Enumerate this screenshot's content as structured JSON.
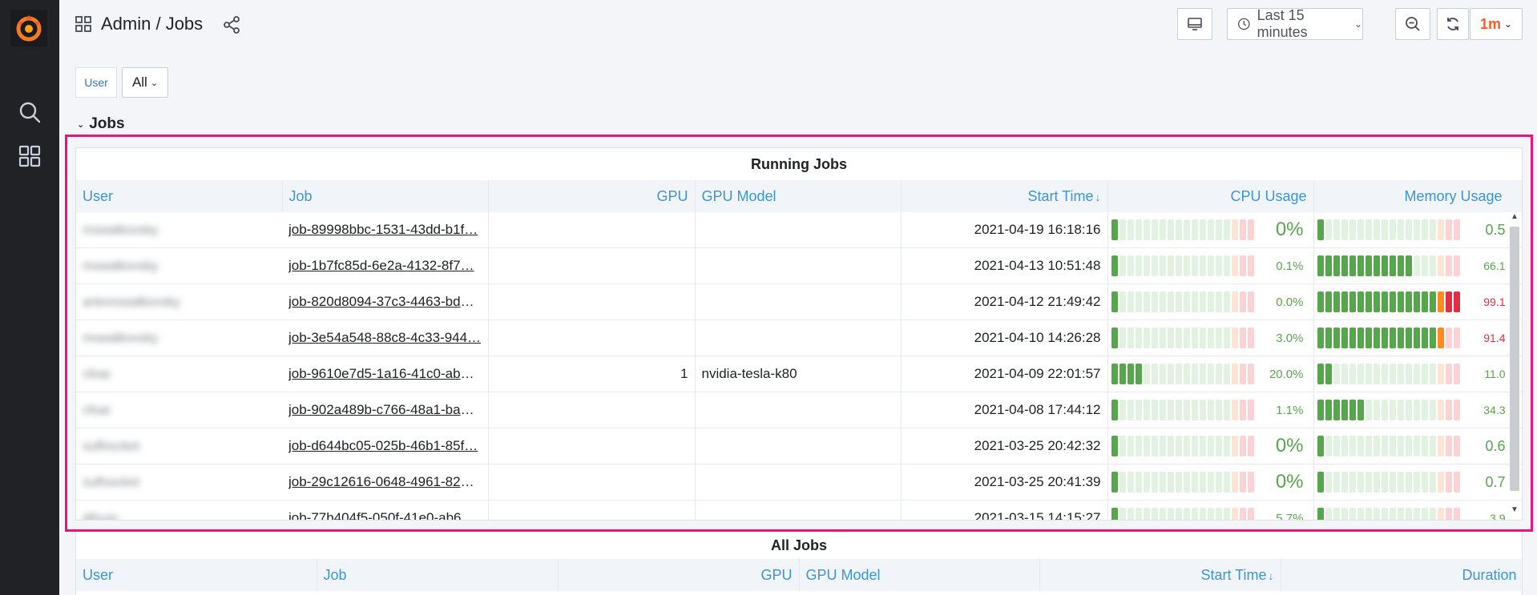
{
  "app": {
    "title": "Admin / Jobs"
  },
  "toolbar": {
    "time_range": "Last 15 minutes",
    "refresh_interval": "1m"
  },
  "variables": {
    "label": "User",
    "value": "All"
  },
  "row": {
    "title": "Jobs"
  },
  "colors": {
    "accent": "#3b95d8",
    "highlight": "#e8157f",
    "good": "#56a64b",
    "warn": "#ff8b1f",
    "bad": "#e02f44"
  },
  "running_jobs": {
    "title": "Running Jobs",
    "columns": [
      "User",
      "Job",
      "GPU",
      "GPU Model",
      "Start Time",
      "CPU Usage",
      "Memory Usage"
    ],
    "sort_arrow": "↓",
    "rows": [
      {
        "user": "mswalkovsky",
        "job": "job-89998bbc-1531-43dd-b1f…",
        "gpu": "",
        "gpu_model": "",
        "start": "2021-04-19 16:18:16",
        "cpu": "0%",
        "cpu_pct": 0,
        "cpu_big": true,
        "mem": "0.5",
        "mem_pct": 0.5,
        "mem_big": true
      },
      {
        "user": "mswalkovsky",
        "job": "job-1b7fc85d-6e2a-4132-8f7…",
        "gpu": "",
        "gpu_model": "",
        "start": "2021-04-13 10:51:48",
        "cpu": "0.1%",
        "cpu_pct": 0.1,
        "cpu_big": false,
        "mem": "66.1",
        "mem_pct": 66.1,
        "mem_big": false
      },
      {
        "user": "artemswalkovsky",
        "job": "job-820d8094-37c3-4463-bde…",
        "gpu": "",
        "gpu_model": "",
        "start": "2021-04-12 21:49:42",
        "cpu": "0.0%",
        "cpu_pct": 0,
        "cpu_big": false,
        "mem": "99.1",
        "mem_pct": 99.1,
        "mem_big": false
      },
      {
        "user": "mswalkovsky",
        "job": "job-3e54a548-88c8-4c33-944…",
        "gpu": "",
        "gpu_model": "",
        "start": "2021-04-10 14:26:28",
        "cpu": "3.0%",
        "cpu_pct": 3,
        "cpu_big": false,
        "mem": "91.4",
        "mem_pct": 91.4,
        "mem_big": false
      },
      {
        "user": "cfoar",
        "job": "job-9610e7d5-1a16-41c0-ab0…",
        "gpu": "1",
        "gpu_model": "nvidia-tesla-k80",
        "start": "2021-04-09 22:01:57",
        "cpu": "20.0%",
        "cpu_pct": 20,
        "cpu_big": false,
        "mem": "11.0",
        "mem_pct": 11,
        "mem_big": false
      },
      {
        "user": "cfoar",
        "job": "job-902a489b-c766-48a1-ba7…",
        "gpu": "",
        "gpu_model": "",
        "start": "2021-04-08 17:44:12",
        "cpu": "1.1%",
        "cpu_pct": 1.1,
        "cpu_big": false,
        "mem": "34.3",
        "mem_pct": 34.3,
        "mem_big": false
      },
      {
        "user": "sulfoscket",
        "job": "job-d644bc05-025b-46b1-85f…",
        "gpu": "",
        "gpu_model": "",
        "start": "2021-03-25 20:42:32",
        "cpu": "0%",
        "cpu_pct": 0,
        "cpu_big": true,
        "mem": "0.6",
        "mem_pct": 0.6,
        "mem_big": true
      },
      {
        "user": "sulfoscket",
        "job": "job-29c12616-0648-4961-828…",
        "gpu": "",
        "gpu_model": "",
        "start": "2021-03-25 20:41:39",
        "cpu": "0%",
        "cpu_pct": 0,
        "cpu_big": true,
        "mem": "0.7",
        "mem_pct": 0.7,
        "mem_big": true
      },
      {
        "user": "dthum",
        "job": "job-77b404f5-050f-41e0-ab6…",
        "gpu": "",
        "gpu_model": "",
        "start": "2021-03-15 14:15:27",
        "cpu": "5.7%",
        "cpu_pct": 5.7,
        "cpu_big": false,
        "mem": "3.9",
        "mem_pct": 3.9,
        "mem_big": false
      }
    ]
  },
  "all_jobs": {
    "title": "All Jobs",
    "columns": [
      "User",
      "Job",
      "GPU",
      "GPU Model",
      "Start Time",
      "Duration"
    ],
    "sort_arrow": "↓"
  }
}
